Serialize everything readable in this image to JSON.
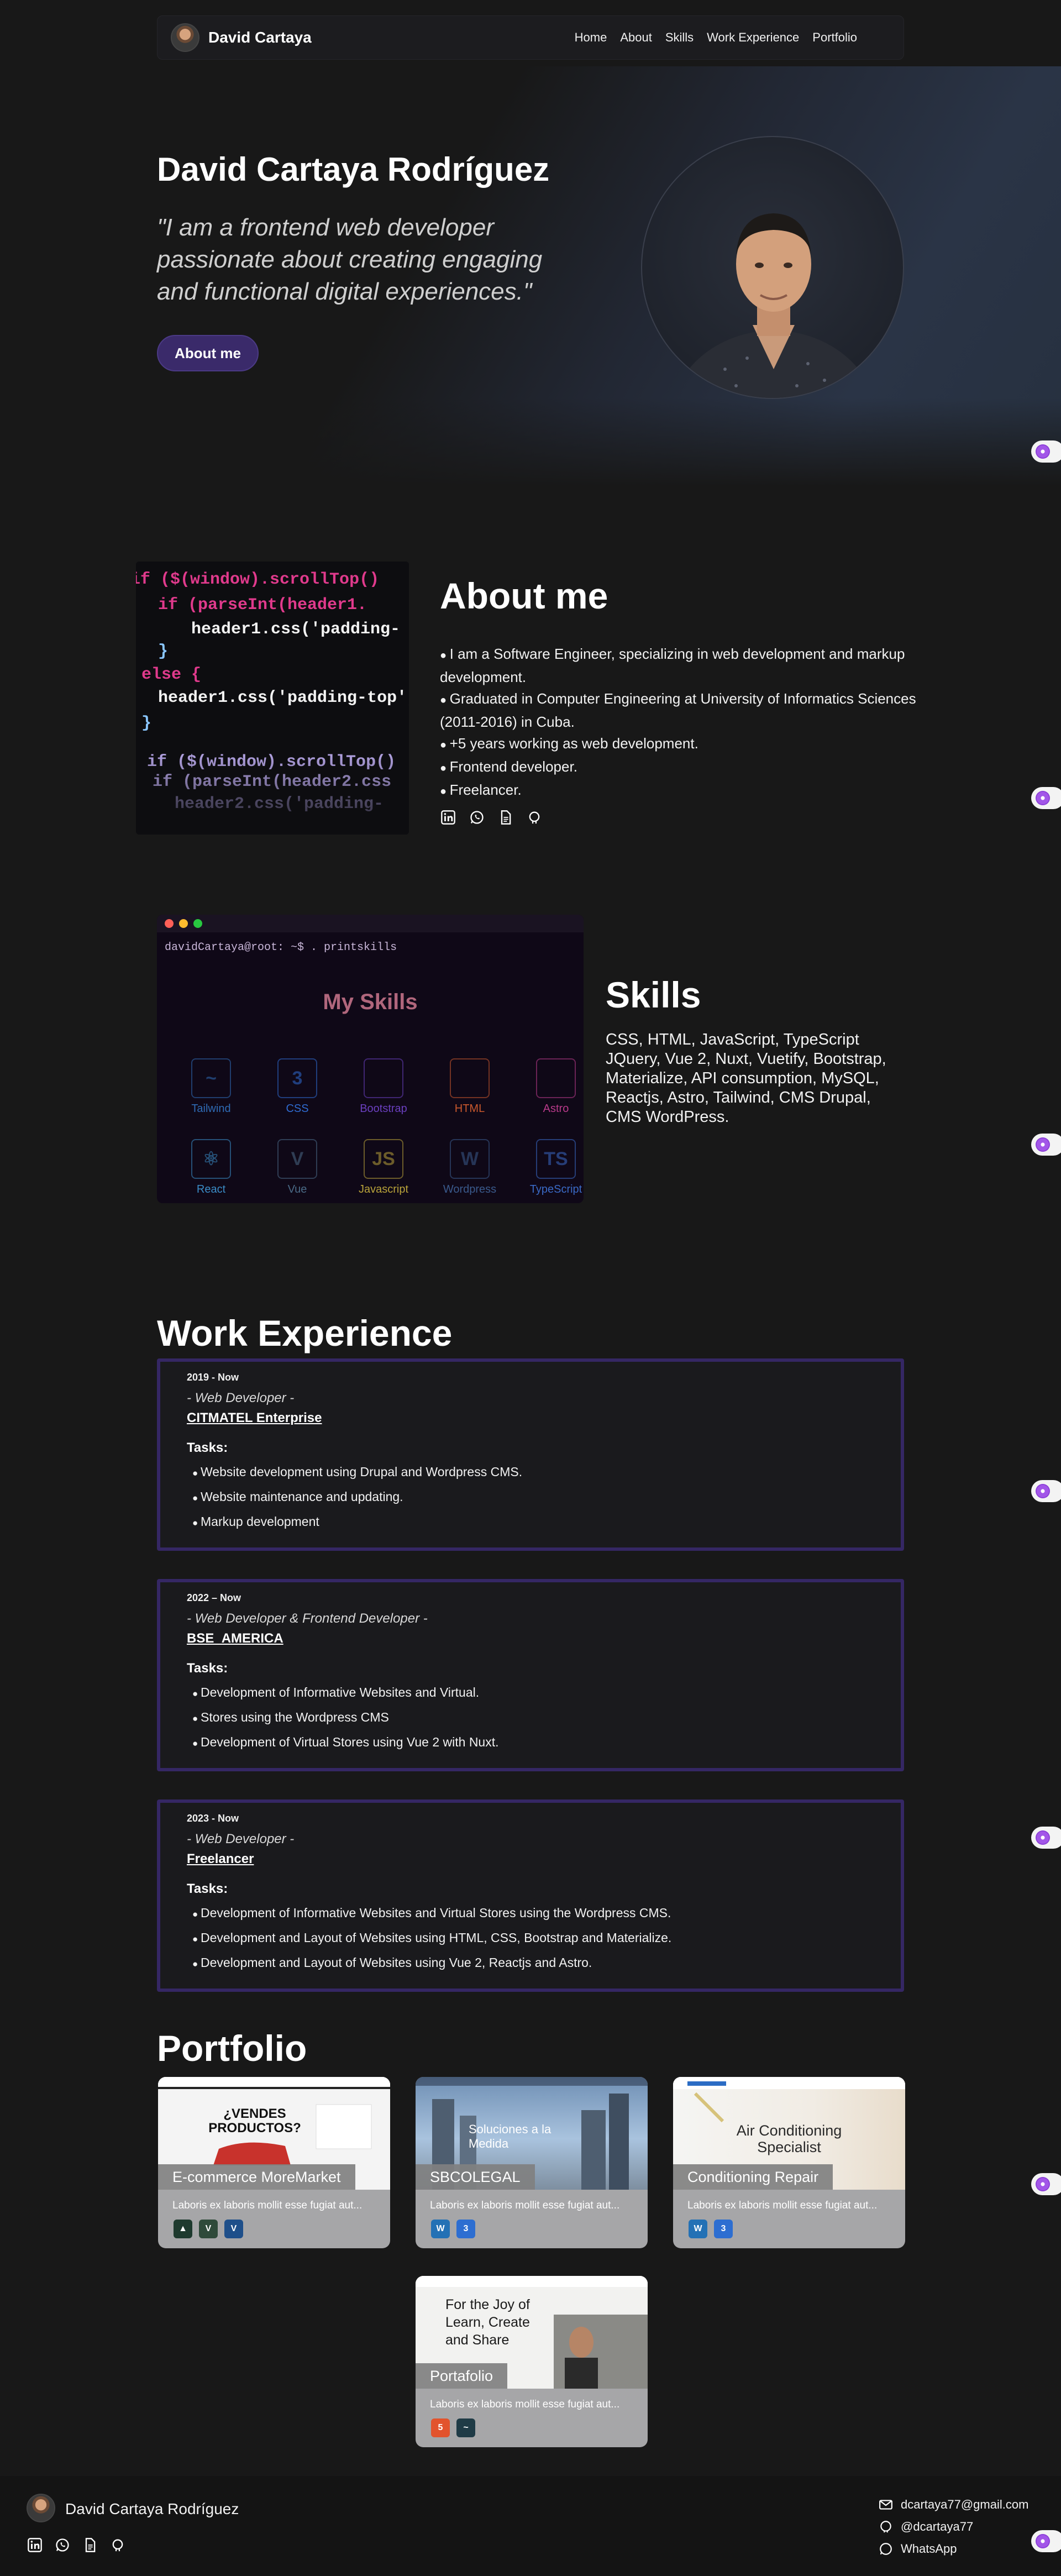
{
  "nav": {
    "name": "David Cartaya",
    "links": [
      "Home",
      "About",
      "Skills",
      "Work Experience",
      "Portfolio"
    ]
  },
  "hero": {
    "title": "David Cartaya Rodríguez",
    "quote": "\"I am a frontend web developer passionate about creating engaging and functional digital experiences.\"",
    "button": "About me"
  },
  "about": {
    "heading": "About me",
    "items": [
      "I am a Software Engineer, specializing in web development and markup development.",
      "Graduated in Computer Engineering at University of Informatics Sciences (2011-2016) in Cuba.",
      "+5 years working as web development.",
      "Frontend developer.",
      "Freelancer."
    ],
    "icons": [
      "linkedin-icon",
      "whatsapp-icon",
      "document-icon",
      "github-icon"
    ]
  },
  "skills": {
    "terminal_prompt": "davidCartaya@root: ~$ . printskills",
    "terminal_title": "My Skills",
    "grid": [
      {
        "label": "Tailwind",
        "glyph": "~",
        "color": "#2f6bb5"
      },
      {
        "label": "CSS",
        "glyph": "3",
        "color": "#2f6bd1"
      },
      {
        "label": "Bootstrap",
        "glyph": "",
        "color": "#6a3fbf"
      },
      {
        "label": "HTML",
        "glyph": "",
        "color": "#c9582d"
      },
      {
        "label": "Astro",
        "glyph": "",
        "color": "#b83a8a"
      },
      {
        "label": "React",
        "glyph": "⚛",
        "color": "#3a8cc6"
      },
      {
        "label": "Vue",
        "glyph": "V",
        "color": "#4a6a86"
      },
      {
        "label": "Javascript",
        "glyph": "JS",
        "color": "#b8a23a"
      },
      {
        "label": "Wordpress",
        "glyph": "W",
        "color": "#3a5a8c"
      },
      {
        "label": "TypeScript",
        "glyph": "TS",
        "color": "#3a6ac6"
      }
    ],
    "heading": "Skills",
    "text": "CSS, HTML, JavaScript, TypeScript JQuery, Vue 2, Nuxt, Vuetify, Bootstrap, Materialize, API consumption, MySQL, Reactjs, Astro, Tailwind, CMS Drupal, CMS WordPress."
  },
  "work": {
    "heading": "Work Experience",
    "jobs": [
      {
        "date": "2019 - Now",
        "role": "- Web Developer -",
        "company": "CITMATEL Enterprise",
        "tasks_label": "Tasks:",
        "tasks": [
          "Website development using Drupal and Wordpress CMS.",
          "Website maintenance and updating.",
          "Markup development"
        ]
      },
      {
        "date": "2022 – Now",
        "role": "- Web Developer & Frontend Developer -",
        "company": "BSE_AMERICA",
        "tasks_label": "Tasks:",
        "tasks": [
          "Development of Informative Websites and Virtual.",
          "Stores using the Wordpress CMS",
          "Development of Virtual Stores using Vue 2 with Nuxt."
        ]
      },
      {
        "date": "2023 - Now",
        "role": "- Web Developer -",
        "company": "Freelancer",
        "tasks_label": "Tasks:",
        "tasks": [
          "Development of Informative Websites and Virtual Stores using the Wordpress CMS.",
          "Development and Layout of Websites using HTML, CSS, Bootstrap and Materialize.",
          "Development and Layout of Websites using Vue 2, Reactjs and Astro."
        ]
      }
    ]
  },
  "portfolio": {
    "heading": "Portfolio",
    "cards": [
      {
        "title": "E-commerce MoreMarket",
        "shot_text": "¿VENDES PRODUCTOS?",
        "desc": "Laboris ex laboris mollit esse fugiat aut...",
        "techs": [
          {
            "name": "nuxt-icon",
            "glyph": "▲",
            "color": "#1e3a2e"
          },
          {
            "name": "vue-icon",
            "glyph": "V",
            "color": "#2f4a3a"
          },
          {
            "name": "vuetify-icon",
            "glyph": "V",
            "color": "#1e4f8a"
          }
        ]
      },
      {
        "title": "SBCOLEGAL",
        "shot_text": "Soluciones a la Medida",
        "desc": "Laboris ex laboris mollit esse fugiat aut...",
        "techs": [
          {
            "name": "wordpress-icon",
            "glyph": "W",
            "color": "#2371b5"
          },
          {
            "name": "css-icon",
            "glyph": "3",
            "color": "#2d6ed1"
          }
        ]
      },
      {
        "title": "Conditioning Repair",
        "shot_text": "Air Conditioning Specialist",
        "desc": "Laboris ex laboris mollit esse fugiat aut...",
        "techs": [
          {
            "name": "wordpress-icon",
            "glyph": "W",
            "color": "#2371b5"
          },
          {
            "name": "css-icon",
            "glyph": "3",
            "color": "#2d6ed1"
          }
        ]
      },
      {
        "title": "Portafolio",
        "shot_text": "For the Joy of Learn, Create and Share",
        "desc": "Laboris ex laboris mollit esse fugiat aut...",
        "techs": [
          {
            "name": "html-icon",
            "glyph": "5",
            "color": "#e2532d"
          },
          {
            "name": "tailwind-icon",
            "glyph": "~",
            "color": "#1f3b46"
          }
        ]
      }
    ]
  },
  "footer": {
    "name": "David Cartaya Rodríguez",
    "email": "dcartaya77@gmail.com",
    "github": "@dcartaya77",
    "whatsapp": "WhatsApp"
  }
}
